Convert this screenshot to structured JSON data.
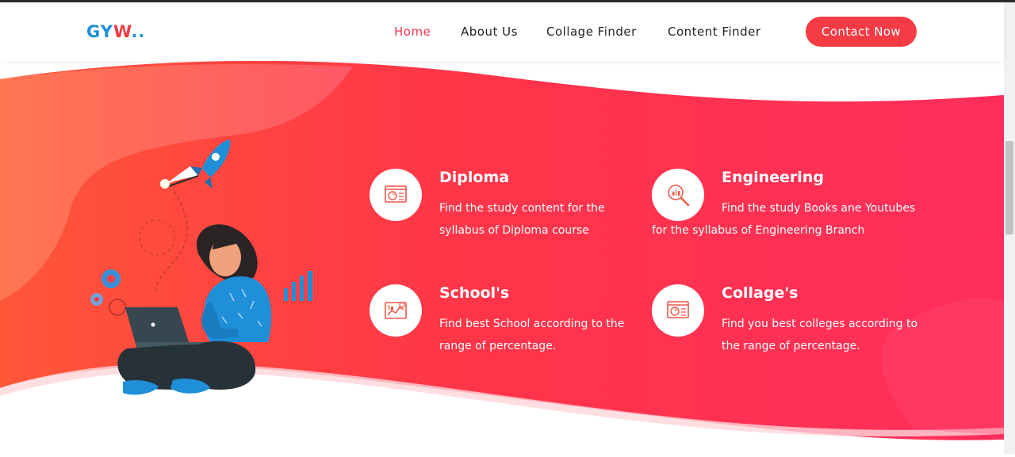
{
  "header": {
    "logo": {
      "part1": "GY",
      "part2": "W",
      "part3": ".."
    },
    "nav": [
      "Home",
      "About Us",
      "Collage Finder",
      "Content Finder"
    ],
    "cta_label": "Contact Now"
  },
  "features": [
    {
      "title": "Diploma",
      "desc": "Find the study content for the syllabus of Diploma course",
      "icon": "report-icon"
    },
    {
      "title": "Engineering",
      "desc": "Find the study Books ane Youtubes for the syllabus of Engineering Branch",
      "icon": "magnifier-chart-icon"
    },
    {
      "title": "School's",
      "desc": "Find best School according to the range of percentage.",
      "icon": "analytics-icon"
    },
    {
      "title": "Collage's",
      "desc": "Find you best colleges according to the range of percentage.",
      "icon": "report-icon"
    }
  ],
  "colors": {
    "accent": "#f53b44",
    "brand_blue": "#1e8fd8",
    "gradient_start": "#ff5a3c",
    "gradient_end": "#ff2d5a"
  }
}
